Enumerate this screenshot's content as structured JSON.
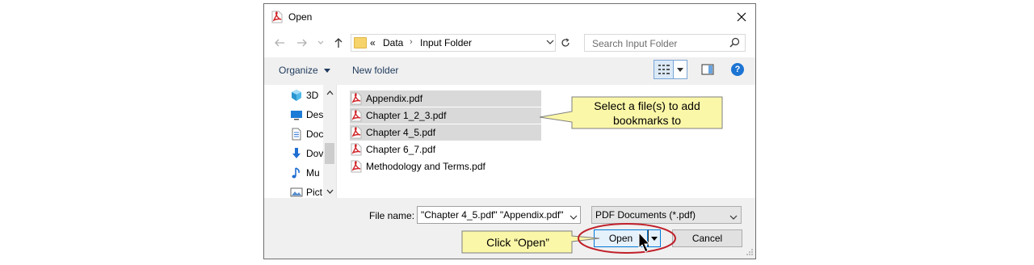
{
  "window": {
    "title": "Open"
  },
  "address_bar": {
    "overflow": "«",
    "crumbs": [
      "Data",
      "Input Folder"
    ]
  },
  "search": {
    "placeholder": "Search Input Folder"
  },
  "toolbar": {
    "organize_label": "Organize",
    "new_folder_label": "New folder"
  },
  "nav_pane": {
    "items": [
      {
        "label": "3D",
        "icon": "3d-objects-icon"
      },
      {
        "label": "Des",
        "icon": "desktop-icon"
      },
      {
        "label": "Doc",
        "icon": "documents-icon"
      },
      {
        "label": "Dov",
        "icon": "downloads-icon"
      },
      {
        "label": "Mu",
        "icon": "music-icon"
      },
      {
        "label": "Pict",
        "icon": "pictures-icon"
      }
    ]
  },
  "files": [
    {
      "name": "Appendix.pdf",
      "selected": true
    },
    {
      "name": "Chapter 1_2_3.pdf",
      "selected": true
    },
    {
      "name": "Chapter 4_5.pdf",
      "selected": true
    },
    {
      "name": "Chapter 6_7.pdf",
      "selected": false
    },
    {
      "name": "Methodology and Terms.pdf",
      "selected": false
    }
  ],
  "file_name": {
    "label": "File name:",
    "value": "\"Chapter 4_5.pdf\" \"Appendix.pdf\""
  },
  "file_type": {
    "value": "PDF Documents (*.pdf)"
  },
  "buttons": {
    "open_label": "Open",
    "cancel_label": "Cancel"
  },
  "callouts": {
    "select_files": {
      "line1": "Select a file(s) to add",
      "line2": "bookmarks to"
    },
    "click_open": "Click “Open”"
  },
  "colors": {
    "callout_fill": "#fbf7a8",
    "callout_border": "#7f7f7f",
    "highlight_ellipse": "#c0202a",
    "accent": "#0078d7"
  }
}
